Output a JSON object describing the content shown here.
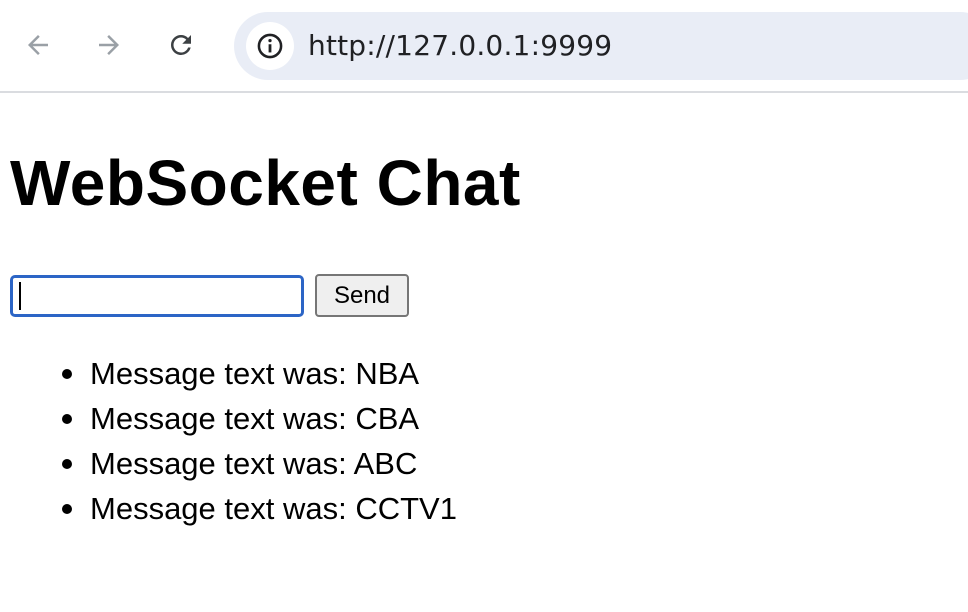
{
  "browser": {
    "back_icon": "arrow-left-icon",
    "forward_icon": "arrow-right-icon",
    "reload_icon": "reload-icon",
    "site_info_icon": "info-circle-icon",
    "url": "http://127.0.0.1:9999"
  },
  "page": {
    "title": "WebSocket Chat",
    "input": {
      "value": "",
      "placeholder": ""
    },
    "send_label": "Send",
    "messages": [
      "Message text was: NBA",
      "Message text was: CBA",
      "Message text was: ABC",
      "Message text was: CCTV1"
    ]
  },
  "colors": {
    "omnibox_bg": "#e9edf6",
    "input_focus_border": "#2c65c6",
    "button_bg": "#efefef"
  }
}
